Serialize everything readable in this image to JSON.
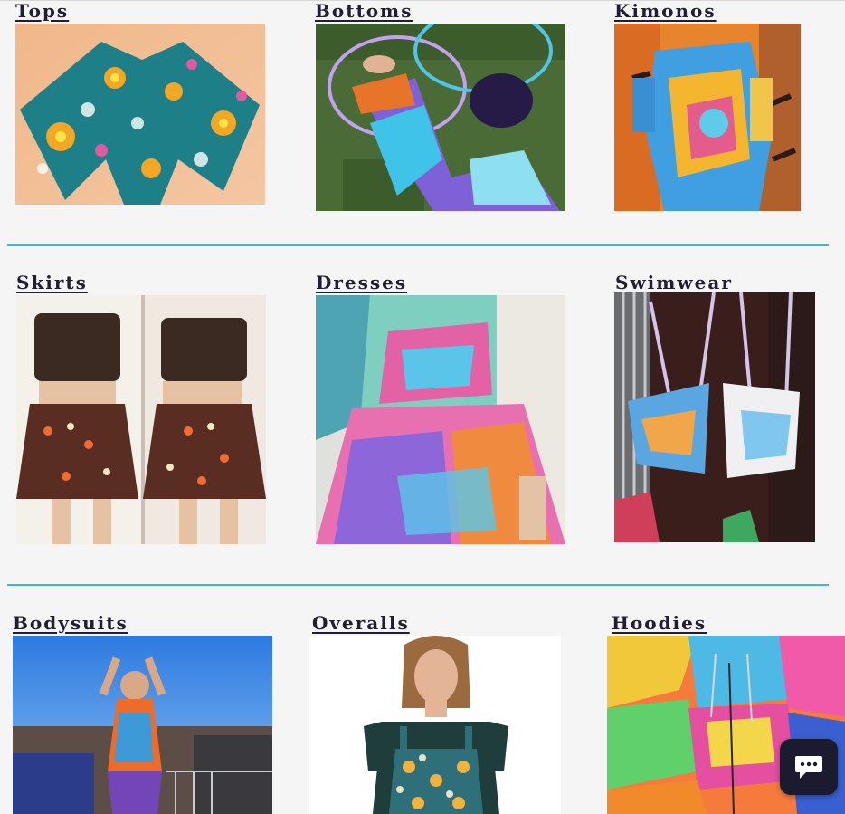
{
  "categories": [
    {
      "label": "Tops"
    },
    {
      "label": "Bottoms"
    },
    {
      "label": "Kimonos"
    },
    {
      "label": "Skirts"
    },
    {
      "label": "Dresses"
    },
    {
      "label": "Swimwear"
    },
    {
      "label": "Bodysuits"
    },
    {
      "label": "Overalls"
    },
    {
      "label": "Hoodies"
    }
  ],
  "colors": {
    "accent_divider": "#3fb6d8",
    "title_text": "#211d33",
    "page_bg": "#f5f5f5",
    "chat_button": "#1c1a2e"
  },
  "chat": {
    "icon": "chat-bubble-icon"
  }
}
